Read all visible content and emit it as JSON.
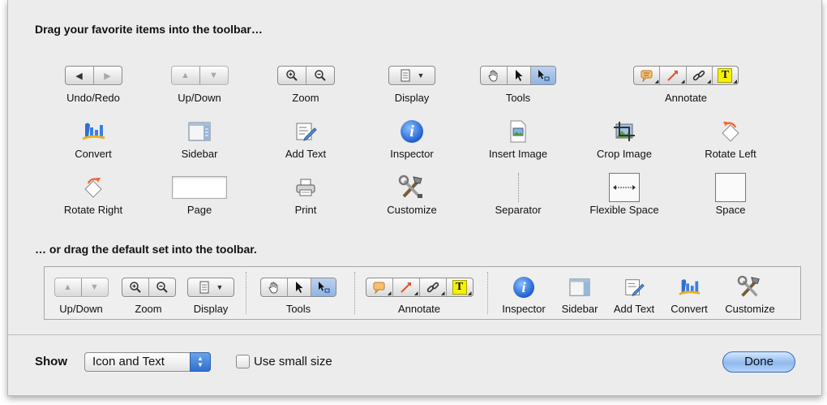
{
  "palette": {
    "heading": "Drag your favorite items into the toolbar…"
  },
  "items": {
    "undo_redo": "Undo/Redo",
    "up_down": "Up/Down",
    "zoom": "Zoom",
    "display": "Display",
    "tools": "Tools",
    "annotate": "Annotate",
    "convert": "Convert",
    "sidebar": "Sidebar",
    "add_text": "Add Text",
    "inspector": "Inspector",
    "insert_image": "Insert Image",
    "crop_image": "Crop Image",
    "rotate_left": "Rotate Left",
    "rotate_right": "Rotate Right",
    "page": "Page",
    "print": "Print",
    "customize": "Customize",
    "separator": "Separator",
    "flexible_space": "Flexible Space",
    "space": "Space"
  },
  "default_set": {
    "heading": "… or drag the default set into the toolbar.",
    "up_down": "Up/Down",
    "zoom": "Zoom",
    "display": "Display",
    "tools": "Tools",
    "annotate": "Annotate",
    "inspector": "Inspector",
    "sidebar": "Sidebar",
    "add_text": "Add Text",
    "convert": "Convert",
    "customize": "Customize"
  },
  "footer": {
    "show_label": "Show",
    "show_value": "Icon and Text",
    "small_size_label": "Use small size",
    "small_size_checked": false,
    "done_label": "Done"
  },
  "glyphs": {
    "text_tool": "T",
    "info": "i"
  }
}
